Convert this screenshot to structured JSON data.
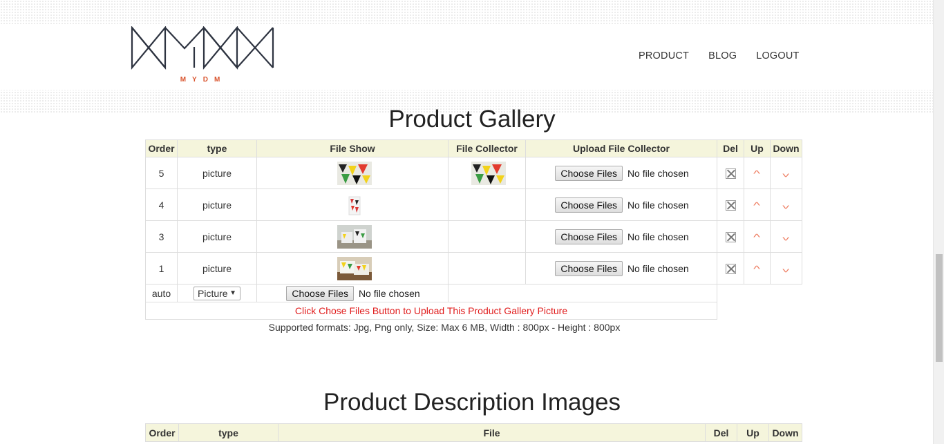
{
  "brand": {
    "logo_text": "MYDM"
  },
  "nav": {
    "items": [
      "PRODUCT",
      "BLOG",
      "LOGOUT"
    ]
  },
  "gallery": {
    "title": "Product Gallery",
    "headers": [
      "Order",
      "type",
      "File Show",
      "File Collector",
      "Upload File Collector",
      "Del",
      "Up",
      "Down"
    ],
    "rows": [
      {
        "order": "5",
        "type": "picture",
        "has_collector": true
      },
      {
        "order": "4",
        "type": "picture",
        "has_collector": false
      },
      {
        "order": "3",
        "type": "picture",
        "has_collector": false
      },
      {
        "order": "1",
        "type": "picture",
        "has_collector": false
      }
    ],
    "choose_label": "Choose Files",
    "no_file_label": "No file chosen",
    "new_row": {
      "order": "auto",
      "type_selected": "Picture",
      "choose_label": "Choose Files",
      "no_file_label": "No file chosen"
    },
    "notice": "Click Chose Files Button to Upload This Product Gallery Picture",
    "formats": "Supported formats: Jpg, Png only, Size: Max 6 MB, Width : 800px - Height : 800px"
  },
  "description": {
    "title": "Product Description Images",
    "headers": [
      "Order",
      "type",
      "File",
      "Del",
      "Up",
      "Down"
    ]
  },
  "colors": {
    "header_bg": "#f5f5dc",
    "notice": "#e01b1b",
    "accent": "#ee7b5f",
    "logo_accent": "#d9532c"
  }
}
